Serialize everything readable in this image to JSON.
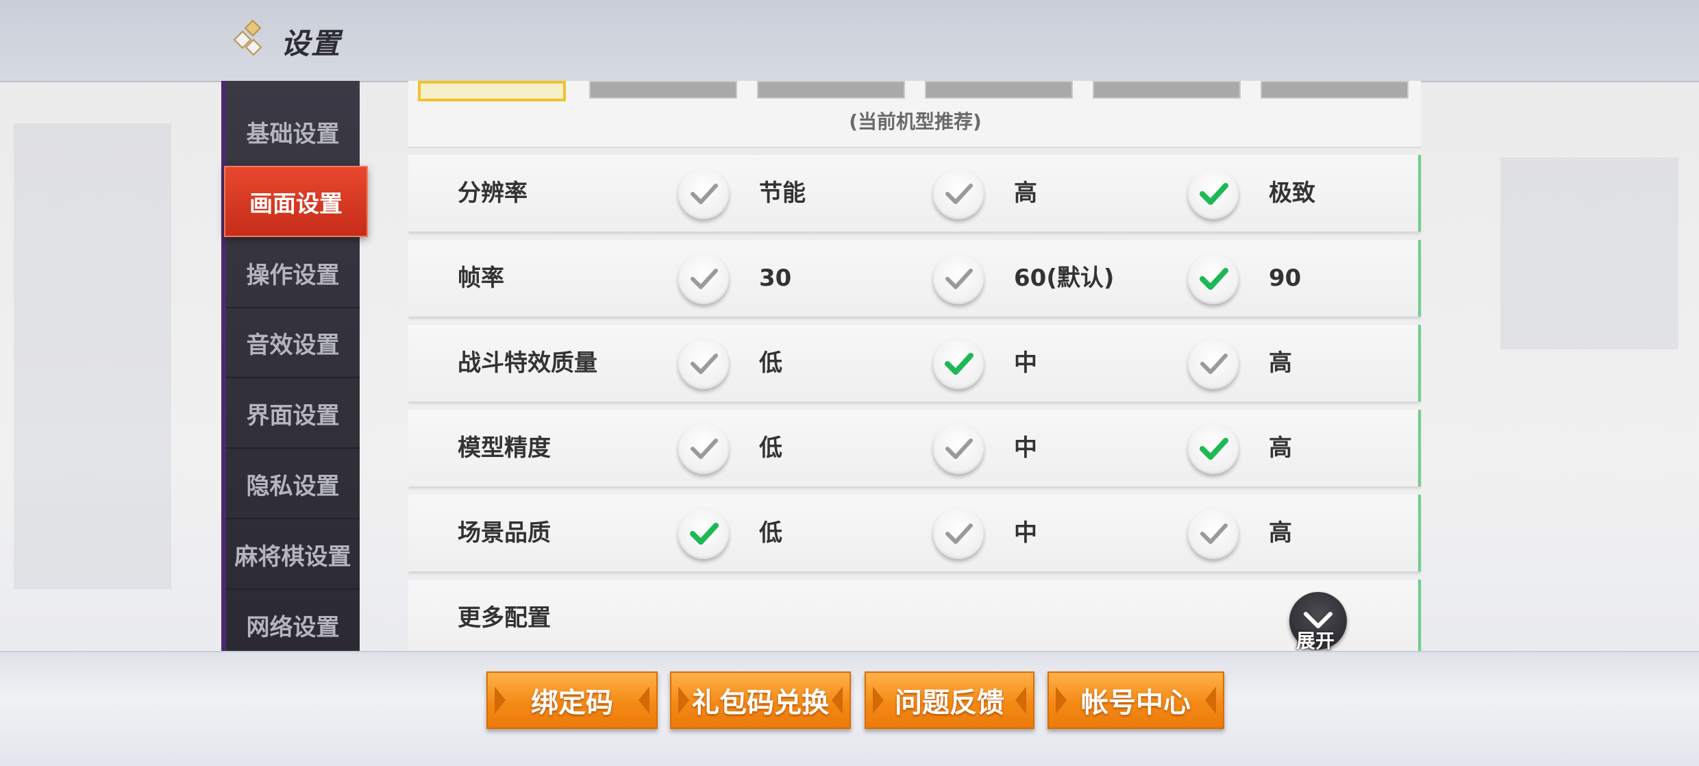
{
  "header": {
    "title": "设置"
  },
  "sidebar": {
    "items": [
      {
        "label": "基础设置",
        "active": false
      },
      {
        "label": "画面设置",
        "active": true
      },
      {
        "label": "操作设置",
        "active": false
      },
      {
        "label": "音效设置",
        "active": false
      },
      {
        "label": "界面设置",
        "active": false
      },
      {
        "label": "隐私设置",
        "active": false
      },
      {
        "label": "麻将棋设置",
        "active": false
      },
      {
        "label": "网络设置",
        "active": false
      }
    ]
  },
  "quality_presets": {
    "selected_index": 0,
    "count": 6,
    "note": "(当前机型推荐)"
  },
  "settings": {
    "rows": [
      {
        "label": "分辨率",
        "options": [
          "节能",
          "高",
          "极致"
        ],
        "selected": 2
      },
      {
        "label": "帧率",
        "options": [
          "30",
          "60(默认)",
          "90"
        ],
        "selected": 2
      },
      {
        "label": "战斗特效质量",
        "options": [
          "低",
          "中",
          "高"
        ],
        "selected": 1
      },
      {
        "label": "模型精度",
        "options": [
          "低",
          "中",
          "高"
        ],
        "selected": 2
      },
      {
        "label": "场景品质",
        "options": [
          "低",
          "中",
          "高"
        ],
        "selected": 0
      }
    ],
    "more": {
      "label": "更多配置",
      "expand_label": "展开"
    }
  },
  "footer": {
    "buttons": [
      "绑定码",
      "礼包码兑换",
      "问题反馈",
      "帐号中心"
    ]
  },
  "colors": {
    "check_selected": "#1db954",
    "check_unselected": "#9a9a9a",
    "accent_active_tab": "#e0412a",
    "button_orange": "#f48a16"
  }
}
